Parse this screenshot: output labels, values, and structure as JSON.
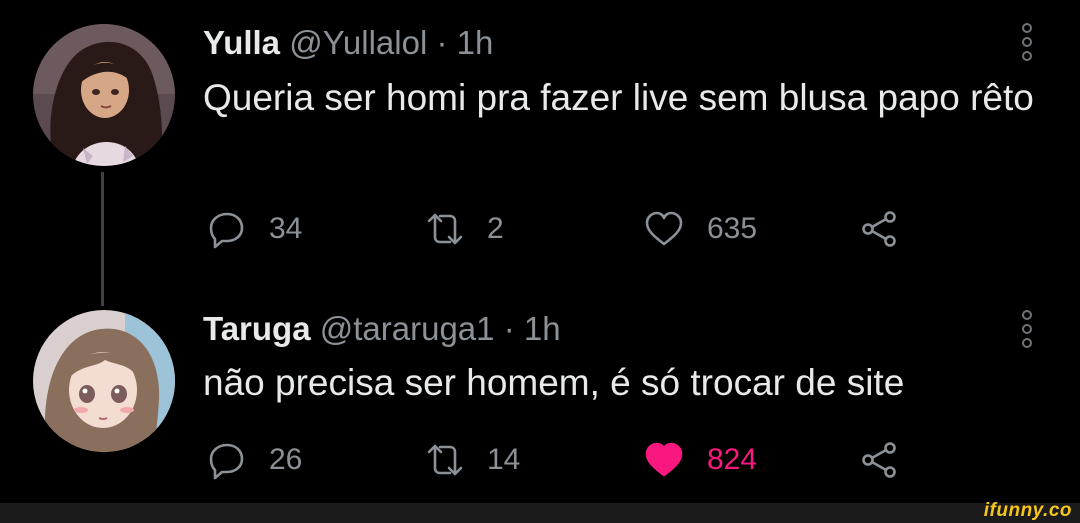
{
  "tweets": [
    {
      "name": "Yulla",
      "handle": "@Yullalol",
      "separator": "·",
      "time": "1h",
      "text": "Queria ser homi pra fazer live sem blusa papo rêto",
      "replies": "34",
      "retweets": "2",
      "likes": "635",
      "liked": false
    },
    {
      "name": "Taruga",
      "handle": "@tararuga1",
      "separator": "·",
      "time": "1h",
      "text": "não precisa ser homem, é só trocar de site",
      "replies": "26",
      "retweets": "14",
      "likes": "824",
      "liked": true
    }
  ],
  "icons": {
    "reply": "reply-icon",
    "retweet": "retweet-icon",
    "like": "heart-icon",
    "share": "share-icon",
    "more": "more-vertical-icon"
  },
  "colors": {
    "background": "#000000",
    "text": "#e7e9ea",
    "muted": "#8b9196",
    "like_active": "#f91880",
    "watermark": "#f6c51a"
  },
  "watermark": "ifunny.co"
}
